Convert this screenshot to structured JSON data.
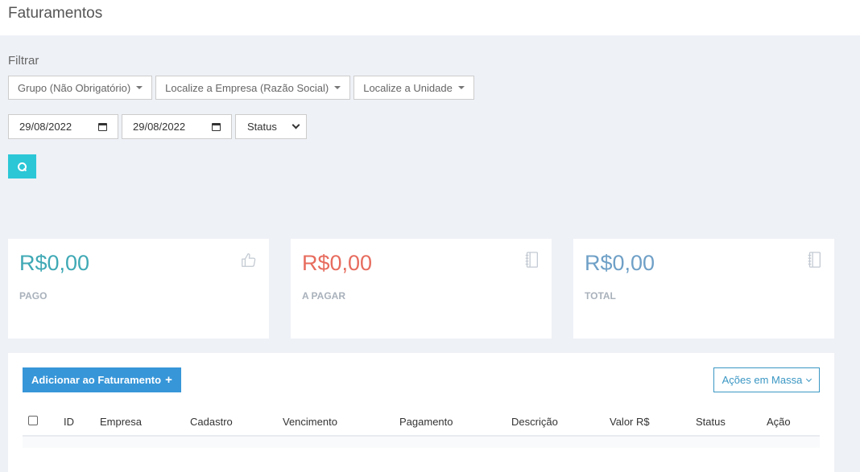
{
  "page": {
    "title": "Faturamentos"
  },
  "filter": {
    "label": "Filtrar",
    "dropdowns": [
      {
        "label": "Grupo (Não Obrigatório)"
      },
      {
        "label": "Localize a Empresa (Razão Social)"
      },
      {
        "label": "Localize a Unidade"
      }
    ],
    "date_start": "29/08/2022",
    "date_end": "29/08/2022",
    "status_select": "Status"
  },
  "cards": [
    {
      "value": "R$0,00",
      "label": "PAGO",
      "icon": "thumbs-up-icon",
      "color": "#3fa9b5"
    },
    {
      "value": "R$0,00",
      "label": "A PAGAR",
      "icon": "notebook-icon",
      "color": "#e76c5e"
    },
    {
      "value": "R$0,00",
      "label": "TOTAL",
      "icon": "notebook-icon",
      "color": "#6fa0c7"
    }
  ],
  "panel": {
    "add_button": "Adicionar ao Faturamento",
    "mass_actions_button": "Ações em Massa",
    "columns": [
      "ID",
      "Empresa",
      "Cadastro",
      "Vencimento",
      "Pagamento",
      "Descrição",
      "Valor R$",
      "Status",
      "Ação"
    ]
  },
  "colors": {
    "search_button": "#2bc7d7",
    "add_button": "#3796d8",
    "background": "#eef1f6"
  }
}
